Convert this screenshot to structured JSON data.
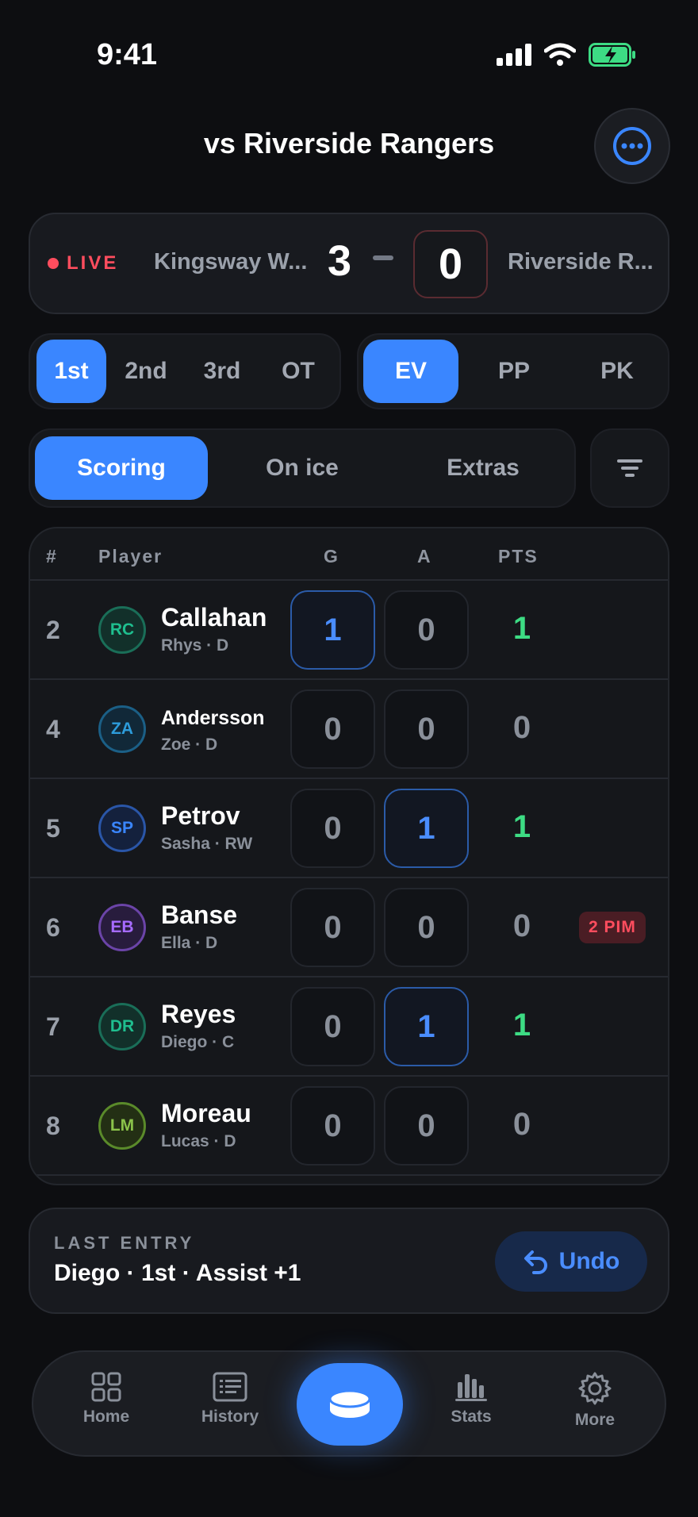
{
  "status": {
    "time": "9:41"
  },
  "header": {
    "title": "vs Riverside Rangers"
  },
  "scoreboard": {
    "live_label": "LIVE",
    "home_team": "Kingsway W...",
    "home_score": "3",
    "away_score": "0",
    "away_team": "Riverside R..."
  },
  "periods": [
    "1st",
    "2nd",
    "3rd",
    "OT"
  ],
  "strength": [
    "EV",
    "PP",
    "PK"
  ],
  "views": [
    "Scoring",
    "On ice",
    "Extras"
  ],
  "table": {
    "headers": {
      "num": "#",
      "player": "Player",
      "g": "G",
      "a": "A",
      "pts": "PTS"
    },
    "rows": [
      {
        "num": "2",
        "initials": "RC",
        "name": "Callahan",
        "sub": "Rhys · D",
        "g": "1",
        "a": "0",
        "pts": "1",
        "color": "#1fbf8f"
      },
      {
        "num": "4",
        "initials": "ZA",
        "name": "Andersson",
        "sub": "Zoe · D",
        "g": "0",
        "a": "0",
        "pts": "0",
        "color": "#2d9cdb"
      },
      {
        "num": "5",
        "initials": "SP",
        "name": "Petrov",
        "sub": "Sasha · RW",
        "g": "0",
        "a": "1",
        "pts": "1",
        "color": "#3a86ff"
      },
      {
        "num": "6",
        "initials": "EB",
        "name": "Banse",
        "sub": "Ella · D",
        "g": "0",
        "a": "0",
        "pts": "0",
        "color": "#a66bff",
        "badge": "2 PIM"
      },
      {
        "num": "7",
        "initials": "DR",
        "name": "Reyes",
        "sub": "Diego · C",
        "g": "0",
        "a": "1",
        "pts": "1",
        "color": "#1fbf8f"
      },
      {
        "num": "8",
        "initials": "LM",
        "name": "Moreau",
        "sub": "Lucas · D",
        "g": "0",
        "a": "0",
        "pts": "0",
        "color": "#8bc34a"
      }
    ]
  },
  "last_entry": {
    "label": "LAST ENTRY",
    "value": "Diego · 1st · Assist +1",
    "undo_label": "Undo"
  },
  "nav": {
    "home": "Home",
    "history": "History",
    "stats": "Stats",
    "more": "More"
  },
  "colors": {
    "accent": "#3a86ff",
    "live": "#ff4d5e",
    "positive": "#3ddc84",
    "background": "#0d0e11"
  }
}
